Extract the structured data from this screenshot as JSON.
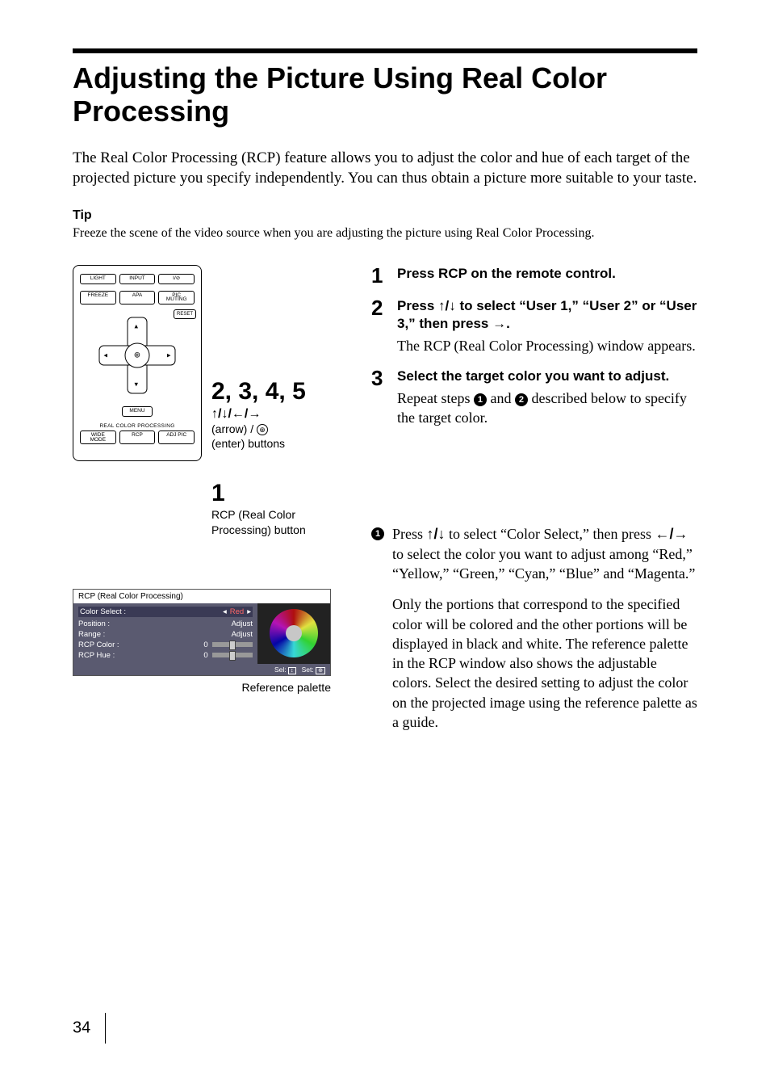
{
  "page_number": "34",
  "title": "Adjusting the Picture Using Real Color Processing",
  "intro": "The Real Color Processing (RCP) feature allows you to adjust the color and hue of each target of the projected picture you specify independently. You can thus obtain a picture more suitable to your taste.",
  "tip_label": "Tip",
  "tip_text": "Freeze the scene of the video source when you are adjusting the picture using Real Color Processing.",
  "remote": {
    "row1": {
      "light": "LIGHT",
      "input": "INPUT",
      "power": "I/⊘"
    },
    "row2": {
      "freeze": "FREEZE",
      "apa": "APA",
      "pic_muting": "PIC MUTING"
    },
    "reset": "RESET",
    "menu": "MENU",
    "rcp_section_label": "REAL COLOR PROCESSING",
    "row3": {
      "wide_mode": "WIDE MODE",
      "rcp": "RCP",
      "adj_pic": "ADJ PIC"
    }
  },
  "callouts": {
    "arrows_num": "2, 3, 4, 5",
    "arrows_symbols": "↑/↓/←/→",
    "arrows_desc1": "(arrow) / ",
    "arrows_desc2": "(enter) buttons",
    "rcp_num": "1",
    "rcp_desc": "RCP (Real Color Processing) button"
  },
  "rcp_window": {
    "title": "RCP (Real Color Processing)",
    "rows": {
      "color_select_label": "Color Select :",
      "color_select_value": "Red",
      "position_label": "Position :",
      "position_value": "Adjust",
      "range_label": "Range :",
      "range_value": "Adjust",
      "rcp_color_label": "RCP Color :",
      "rcp_color_value": "0",
      "rcp_hue_label": "RCP Hue :",
      "rcp_hue_value": "0"
    },
    "footer_sel": "Sel:",
    "footer_set": "Set:",
    "caption": "Reference palette"
  },
  "steps": {
    "s1": {
      "num": "1",
      "head": "Press RCP on the remote control."
    },
    "s2": {
      "num": "2",
      "head_pre": "Press ",
      "head_arrows": "↑/↓",
      "head_post": " to select “User 1,” “User 2” or “User 3,” then press →.",
      "text": "The RCP (Real Color Processing) window appears."
    },
    "s3": {
      "num": "3",
      "head": "Select the target color you want to adjust.",
      "text_pre": "Repeat steps ",
      "text_mid": " and ",
      "text_post": " described below to specify the target color."
    },
    "sub1": {
      "num": "1",
      "line1_pre": "Press ",
      "line1_arrows": "↑/↓",
      "line1_post": " to select “Color Select,” then press ",
      "line1_lr": "←/→",
      "line1_end": " to select the color you want to adjust among “Red,” “Yellow,” “Green,” “Cyan,” “Blue” and “Magenta.”",
      "para2": "Only the portions that correspond to the specified color will be colored and the other portions will be displayed in black and white. The reference palette in the RCP window also shows the adjustable colors. Select the desired setting to adjust the color on the projected image using the reference palette as a guide."
    }
  }
}
